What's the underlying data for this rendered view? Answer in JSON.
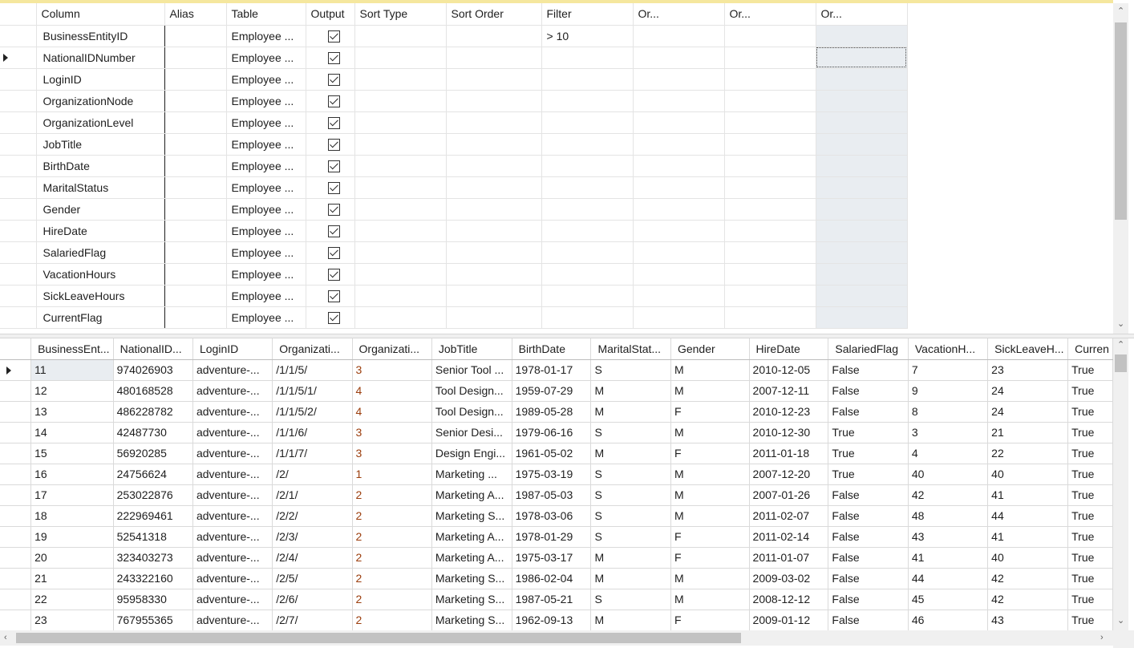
{
  "criteria": {
    "headers": [
      "Column",
      "Alias",
      "Table",
      "Output",
      "Sort Type",
      "Sort Order",
      "Filter",
      "Or...",
      "Or...",
      "Or..."
    ],
    "rows": [
      {
        "column": "BusinessEntityID",
        "alias": "",
        "table": "Employee ...",
        "output": true,
        "filter": "> 10"
      },
      {
        "column": "NationalIDNumber",
        "alias": "",
        "table": "Employee ...",
        "output": true,
        "filter": ""
      },
      {
        "column": "LoginID",
        "alias": "",
        "table": "Employee ...",
        "output": true,
        "filter": ""
      },
      {
        "column": "OrganizationNode",
        "alias": "",
        "table": "Employee ...",
        "output": true,
        "filter": ""
      },
      {
        "column": "OrganizationLevel",
        "alias": "",
        "table": "Employee ...",
        "output": true,
        "filter": ""
      },
      {
        "column": "JobTitle",
        "alias": "",
        "table": "Employee ...",
        "output": true,
        "filter": ""
      },
      {
        "column": "BirthDate",
        "alias": "",
        "table": "Employee ...",
        "output": true,
        "filter": ""
      },
      {
        "column": "MaritalStatus",
        "alias": "",
        "table": "Employee ...",
        "output": true,
        "filter": ""
      },
      {
        "column": "Gender",
        "alias": "",
        "table": "Employee ...",
        "output": true,
        "filter": ""
      },
      {
        "column": "HireDate",
        "alias": "",
        "table": "Employee ...",
        "output": true,
        "filter": ""
      },
      {
        "column": "SalariedFlag",
        "alias": "",
        "table": "Employee ...",
        "output": true,
        "filter": ""
      },
      {
        "column": "VacationHours",
        "alias": "",
        "table": "Employee ...",
        "output": true,
        "filter": ""
      },
      {
        "column": "SickLeaveHours",
        "alias": "",
        "table": "Employee ...",
        "output": true,
        "filter": ""
      },
      {
        "column": "CurrentFlag",
        "alias": "",
        "table": "Employee ...",
        "output": true,
        "filter": ""
      }
    ]
  },
  "results": {
    "headers": [
      "BusinessEnt...",
      "NationalID...",
      "LoginID",
      "Organizati...",
      "Organizati...",
      "JobTitle",
      "BirthDate",
      "MaritalStat...",
      "Gender",
      "HireDate",
      "SalariedFlag",
      "VacationH...",
      "SickLeaveH...",
      "Curren"
    ],
    "rows": [
      [
        "11",
        "974026903",
        "adventure-...",
        "/1/1/5/",
        "3",
        "Senior Tool ...",
        "1978-01-17",
        "S",
        "M",
        "2010-12-05",
        "False",
        "7",
        "23",
        "True"
      ],
      [
        "12",
        "480168528",
        "adventure-...",
        "/1/1/5/1/",
        "4",
        "Tool Design...",
        "1959-07-29",
        "M",
        "M",
        "2007-12-11",
        "False",
        "9",
        "24",
        "True"
      ],
      [
        "13",
        "486228782",
        "adventure-...",
        "/1/1/5/2/",
        "4",
        "Tool Design...",
        "1989-05-28",
        "M",
        "F",
        "2010-12-23",
        "False",
        "8",
        "24",
        "True"
      ],
      [
        "14",
        "42487730",
        "adventure-...",
        "/1/1/6/",
        "3",
        "Senior Desi...",
        "1979-06-16",
        "S",
        "M",
        "2010-12-30",
        "True",
        "3",
        "21",
        "True"
      ],
      [
        "15",
        "56920285",
        "adventure-...",
        "/1/1/7/",
        "3",
        "Design Engi...",
        "1961-05-02",
        "M",
        "F",
        "2011-01-18",
        "True",
        "4",
        "22",
        "True"
      ],
      [
        "16",
        "24756624",
        "adventure-...",
        "/2/",
        "1",
        "Marketing ...",
        "1975-03-19",
        "S",
        "M",
        "2007-12-20",
        "True",
        "40",
        "40",
        "True"
      ],
      [
        "17",
        "253022876",
        "adventure-...",
        "/2/1/",
        "2",
        "Marketing A...",
        "1987-05-03",
        "S",
        "M",
        "2007-01-26",
        "False",
        "42",
        "41",
        "True"
      ],
      [
        "18",
        "222969461",
        "adventure-...",
        "/2/2/",
        "2",
        "Marketing S...",
        "1978-03-06",
        "S",
        "M",
        "2011-02-07",
        "False",
        "48",
        "44",
        "True"
      ],
      [
        "19",
        "52541318",
        "adventure-...",
        "/2/3/",
        "2",
        "Marketing A...",
        "1978-01-29",
        "S",
        "F",
        "2011-02-14",
        "False",
        "43",
        "41",
        "True"
      ],
      [
        "20",
        "323403273",
        "adventure-...",
        "/2/4/",
        "2",
        "Marketing A...",
        "1975-03-17",
        "M",
        "F",
        "2011-01-07",
        "False",
        "41",
        "40",
        "True"
      ],
      [
        "21",
        "243322160",
        "adventure-...",
        "/2/5/",
        "2",
        "Marketing S...",
        "1986-02-04",
        "M",
        "M",
        "2009-03-02",
        "False",
        "44",
        "42",
        "True"
      ],
      [
        "22",
        "95958330",
        "adventure-...",
        "/2/6/",
        "2",
        "Marketing S...",
        "1987-05-21",
        "S",
        "M",
        "2008-12-12",
        "False",
        "45",
        "42",
        "True"
      ],
      [
        "23",
        "767955365",
        "adventure-...",
        "/2/7/",
        "2",
        "Marketing S...",
        "1962-09-13",
        "M",
        "F",
        "2009-01-12",
        "False",
        "46",
        "43",
        "True"
      ]
    ]
  },
  "icons": {
    "row_pointer": "row-pointer-icon",
    "checkbox": "checkbox-checked-icon"
  }
}
